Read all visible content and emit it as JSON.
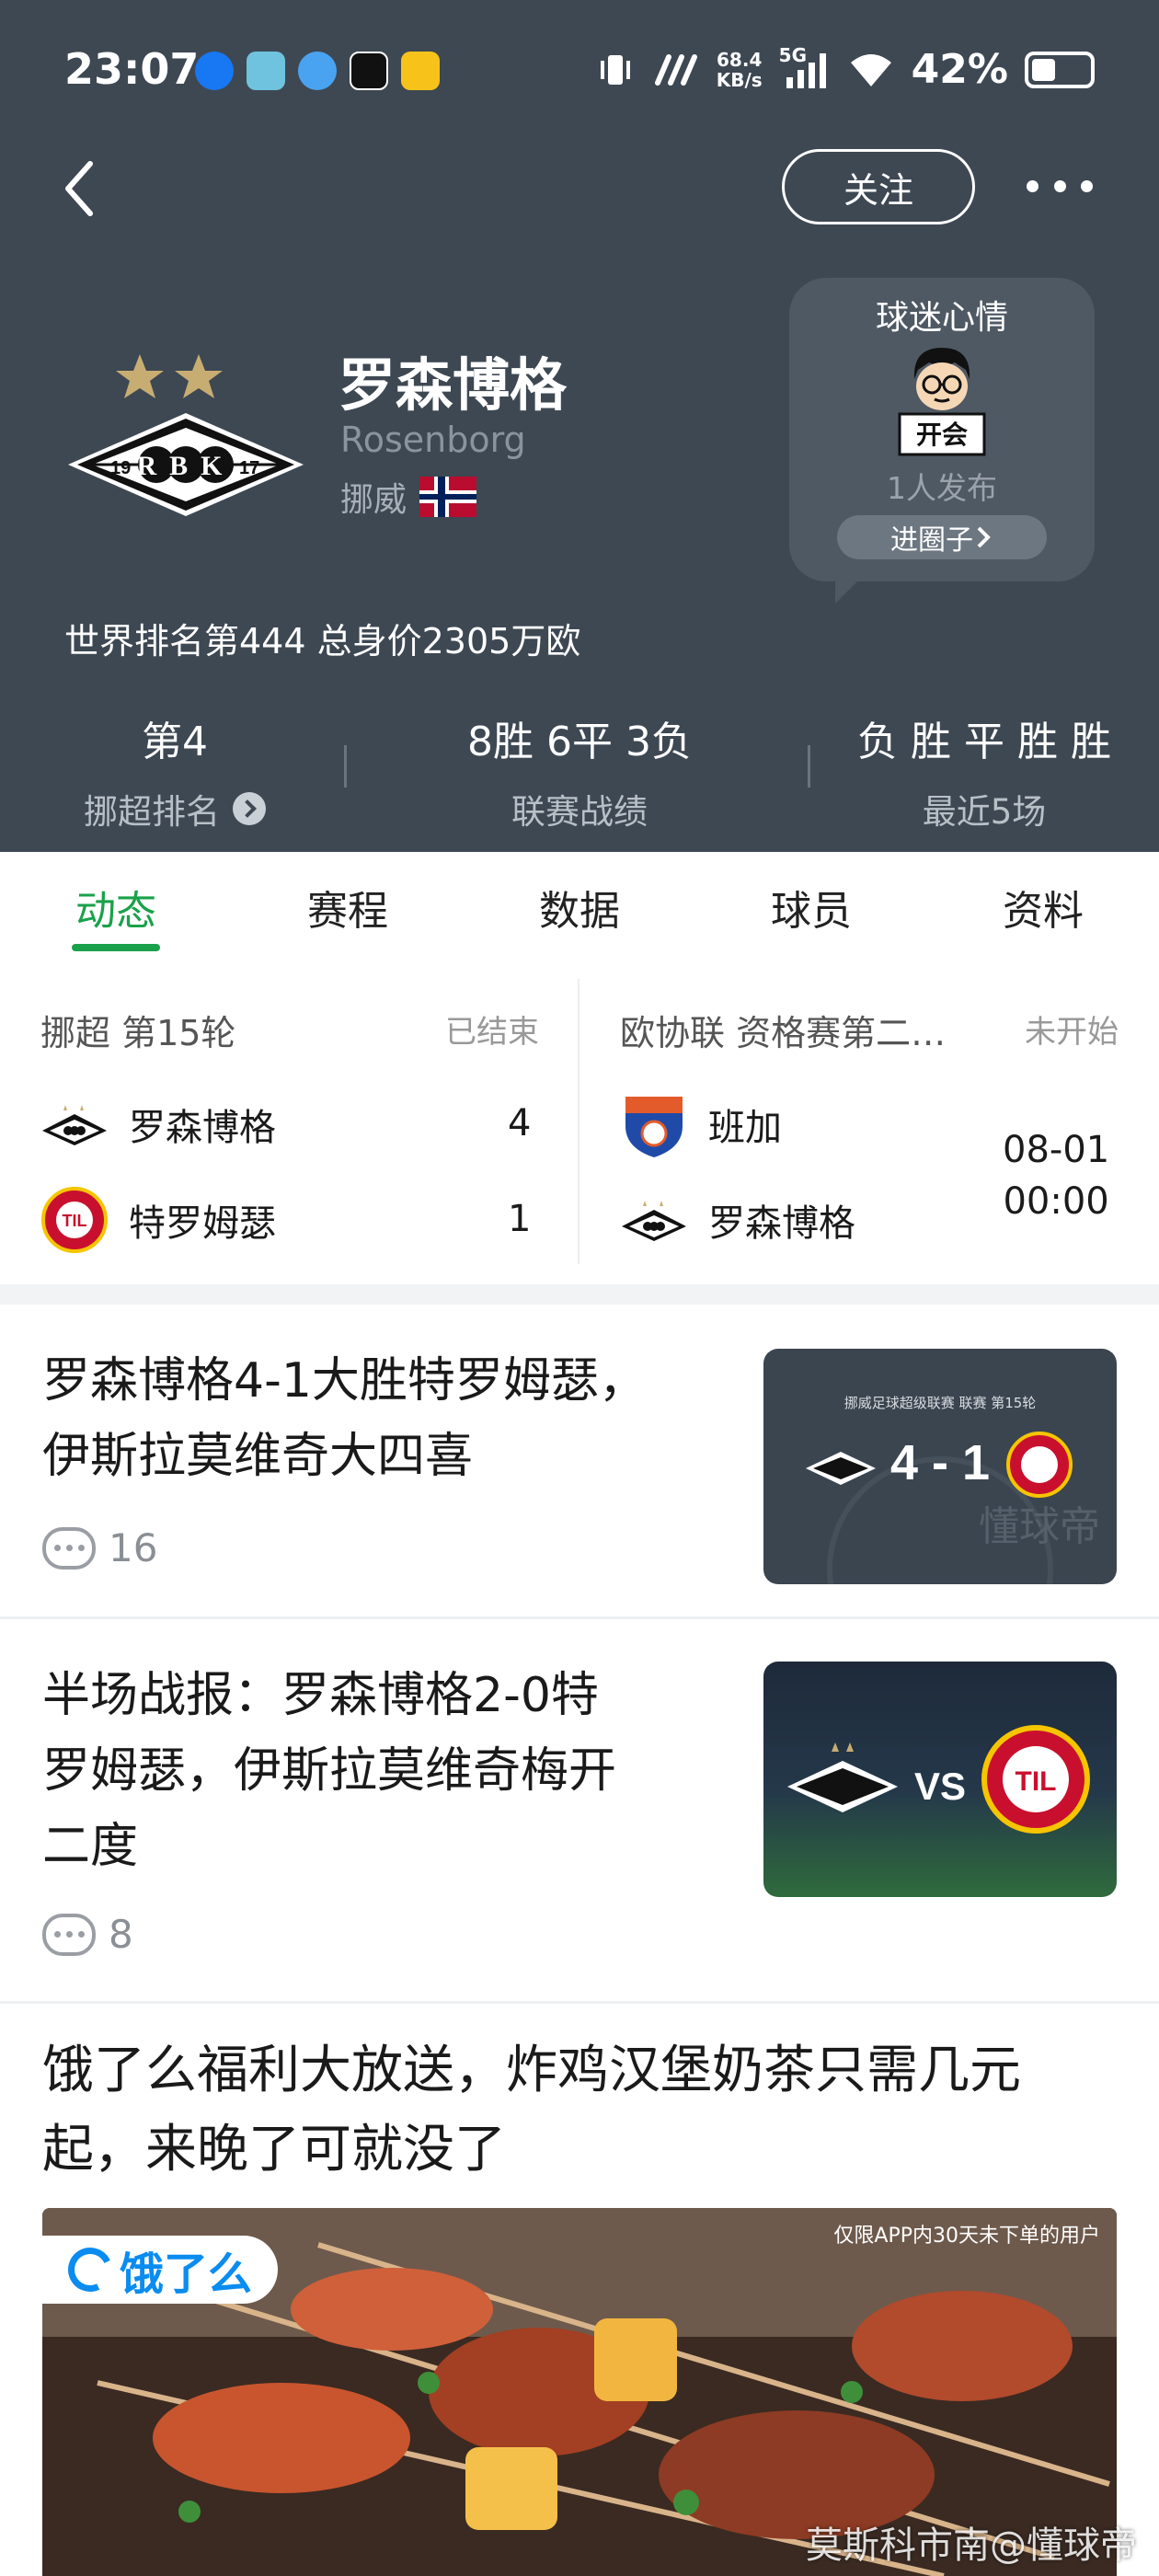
{
  "status_bar": {
    "time": "23:07",
    "net_speed_value": "68.4",
    "net_speed_unit": "KB/s",
    "signal_label": "5G",
    "battery": "42%",
    "battery_level": 0.42
  },
  "header": {
    "follow_label": "关注",
    "team_name": "罗森博格",
    "team_name_en": "Rosenborg",
    "country": "挪威",
    "world_rank": "世界排名第444  总身价2305万欧",
    "crest_text": "RBK",
    "crest_left": "19",
    "crest_right": "17",
    "fan_card": {
      "title": "球迷心情",
      "avatar_text": "开会",
      "count": "1人发布",
      "join_label": "进圈子"
    },
    "stats": [
      {
        "value": "第4",
        "label": "挪超排名"
      },
      {
        "value": "8胜 6平 3负",
        "label": "联赛战绩"
      },
      {
        "value": "负 胜 平 胜 胜",
        "label": "最近5场"
      }
    ]
  },
  "tabs": [
    "动态",
    "赛程",
    "数据",
    "球员",
    "资料"
  ],
  "matches": [
    {
      "league": "挪超 第15轮",
      "status": "已结束",
      "home": {
        "name": "罗森博格",
        "score": "4"
      },
      "away": {
        "name": "特罗姆瑟",
        "score": "1"
      }
    },
    {
      "league": "欧协联 资格赛第二…",
      "status": "未开始",
      "home": {
        "name": "班加"
      },
      "away": {
        "name": "罗森博格"
      },
      "date": "08-01",
      "time": "00:00"
    }
  ],
  "news": [
    {
      "title_line1": "罗森博格4-1大胜特罗姆瑟，",
      "title_line2": "伊斯拉莫维奇大四喜",
      "comments": "16",
      "thumb_caption": "挪威足球超级联赛 联赛 第15轮",
      "thumb_score": "4 - 1",
      "thumb_watermark": "懂球帝"
    },
    {
      "title_line1": "半场战报：罗森博格2-0特",
      "title_line2": "罗姆瑟，伊斯拉莫维奇梅开",
      "title_line3": "二度",
      "comments": "8",
      "thumb_vs": "VS"
    }
  ],
  "ad": {
    "title_line1": "饿了么福利大放送，炸鸡汉堡奶茶只需几元",
    "title_line2": "起，来晚了可就没了",
    "brand": "饿了么",
    "note": "仅限APP内30天未下单的用户"
  },
  "watermark": "莫斯科市南@懂球帝",
  "colors": {
    "header_bg": "#3e4853",
    "accent_green": "#1aa14b",
    "tab_text": "#222222",
    "gray_text": "#999999"
  }
}
